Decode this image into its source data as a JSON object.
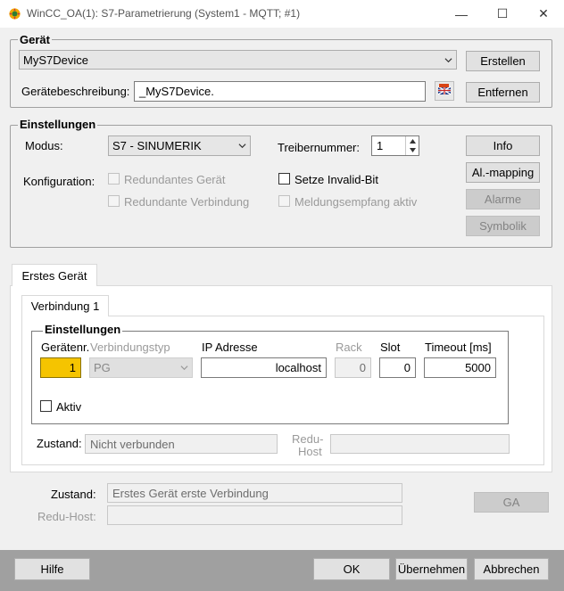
{
  "window": {
    "title": "WinCC_OA(1): S7-Parametrierung (System1 - MQTT; #1)",
    "minimize": "—",
    "maximize": "☐",
    "close": "✕"
  },
  "geraet": {
    "group_label": "Gerät",
    "device_select": "MyS7Device",
    "create_button": "Erstellen",
    "description_label": "Gerätebeschreibung:",
    "description_value": "_MyS7Device.",
    "remove_button": "Entfernen"
  },
  "einstellungen": {
    "group_label": "Einstellungen",
    "modus_label": "Modus:",
    "modus_value": "S7 - SINUMERIK",
    "treibernummer_label": "Treibernummer:",
    "treibernummer_value": "1",
    "konfiguration_label": "Konfiguration:",
    "redundantes_geraet": "Redundantes Gerät",
    "redundante_verbindung": "Redundante Verbindung",
    "setze_invalid_bit": "Setze Invalid-Bit",
    "meldungsempfang_aktiv": "Meldungsempfang aktiv",
    "info_button": "Info",
    "al_mapping_button": "Al.-mapping",
    "alarme_button": "Alarme",
    "symbolik_button": "Symbolik"
  },
  "device_tab": {
    "tab_label": "Erstes Gerät",
    "connection_tab_label": "Verbindung 1",
    "inner_group_label": "Einstellungen",
    "geraetenr_label": "Gerätenr.",
    "geraetenr_value": "1",
    "verbindungstyp_label": "Verbindungstyp",
    "verbindungstyp_value": "PG",
    "ip_label": "IP Adresse",
    "ip_value": "localhost",
    "rack_label": "Rack",
    "rack_value": "0",
    "slot_label": "Slot",
    "slot_value": "0",
    "timeout_label": "Timeout [ms]",
    "timeout_value": "5000",
    "aktiv_label": "Aktiv",
    "zustand_label": "Zustand:",
    "zustand_value": "Nicht verbunden",
    "redu_host_label_1": "Redu-",
    "redu_host_label_2": "Host",
    "redu_host_value": ""
  },
  "status": {
    "zustand_label": "Zustand:",
    "zustand_value": "Erstes Gerät erste Verbindung",
    "redu_host_label": "Redu-Host:",
    "redu_host_value": "",
    "ga_button": "GA"
  },
  "footer": {
    "hilfe_button": "Hilfe",
    "ok_button": "OK",
    "uebernehmen_button": "Übernehmen",
    "abbrechen_button": "Abbrechen"
  },
  "colors": {
    "highlight_field": "#f5c400",
    "bottom_bar": "#a0a0a0"
  },
  "icons": {
    "app": "wincc-oa-app-icon",
    "delete_description": "flag-eraser-icon",
    "dropdown": "chevron-down-icon",
    "spin_up": "spin-up-icon",
    "spin_down": "spin-down-icon"
  }
}
